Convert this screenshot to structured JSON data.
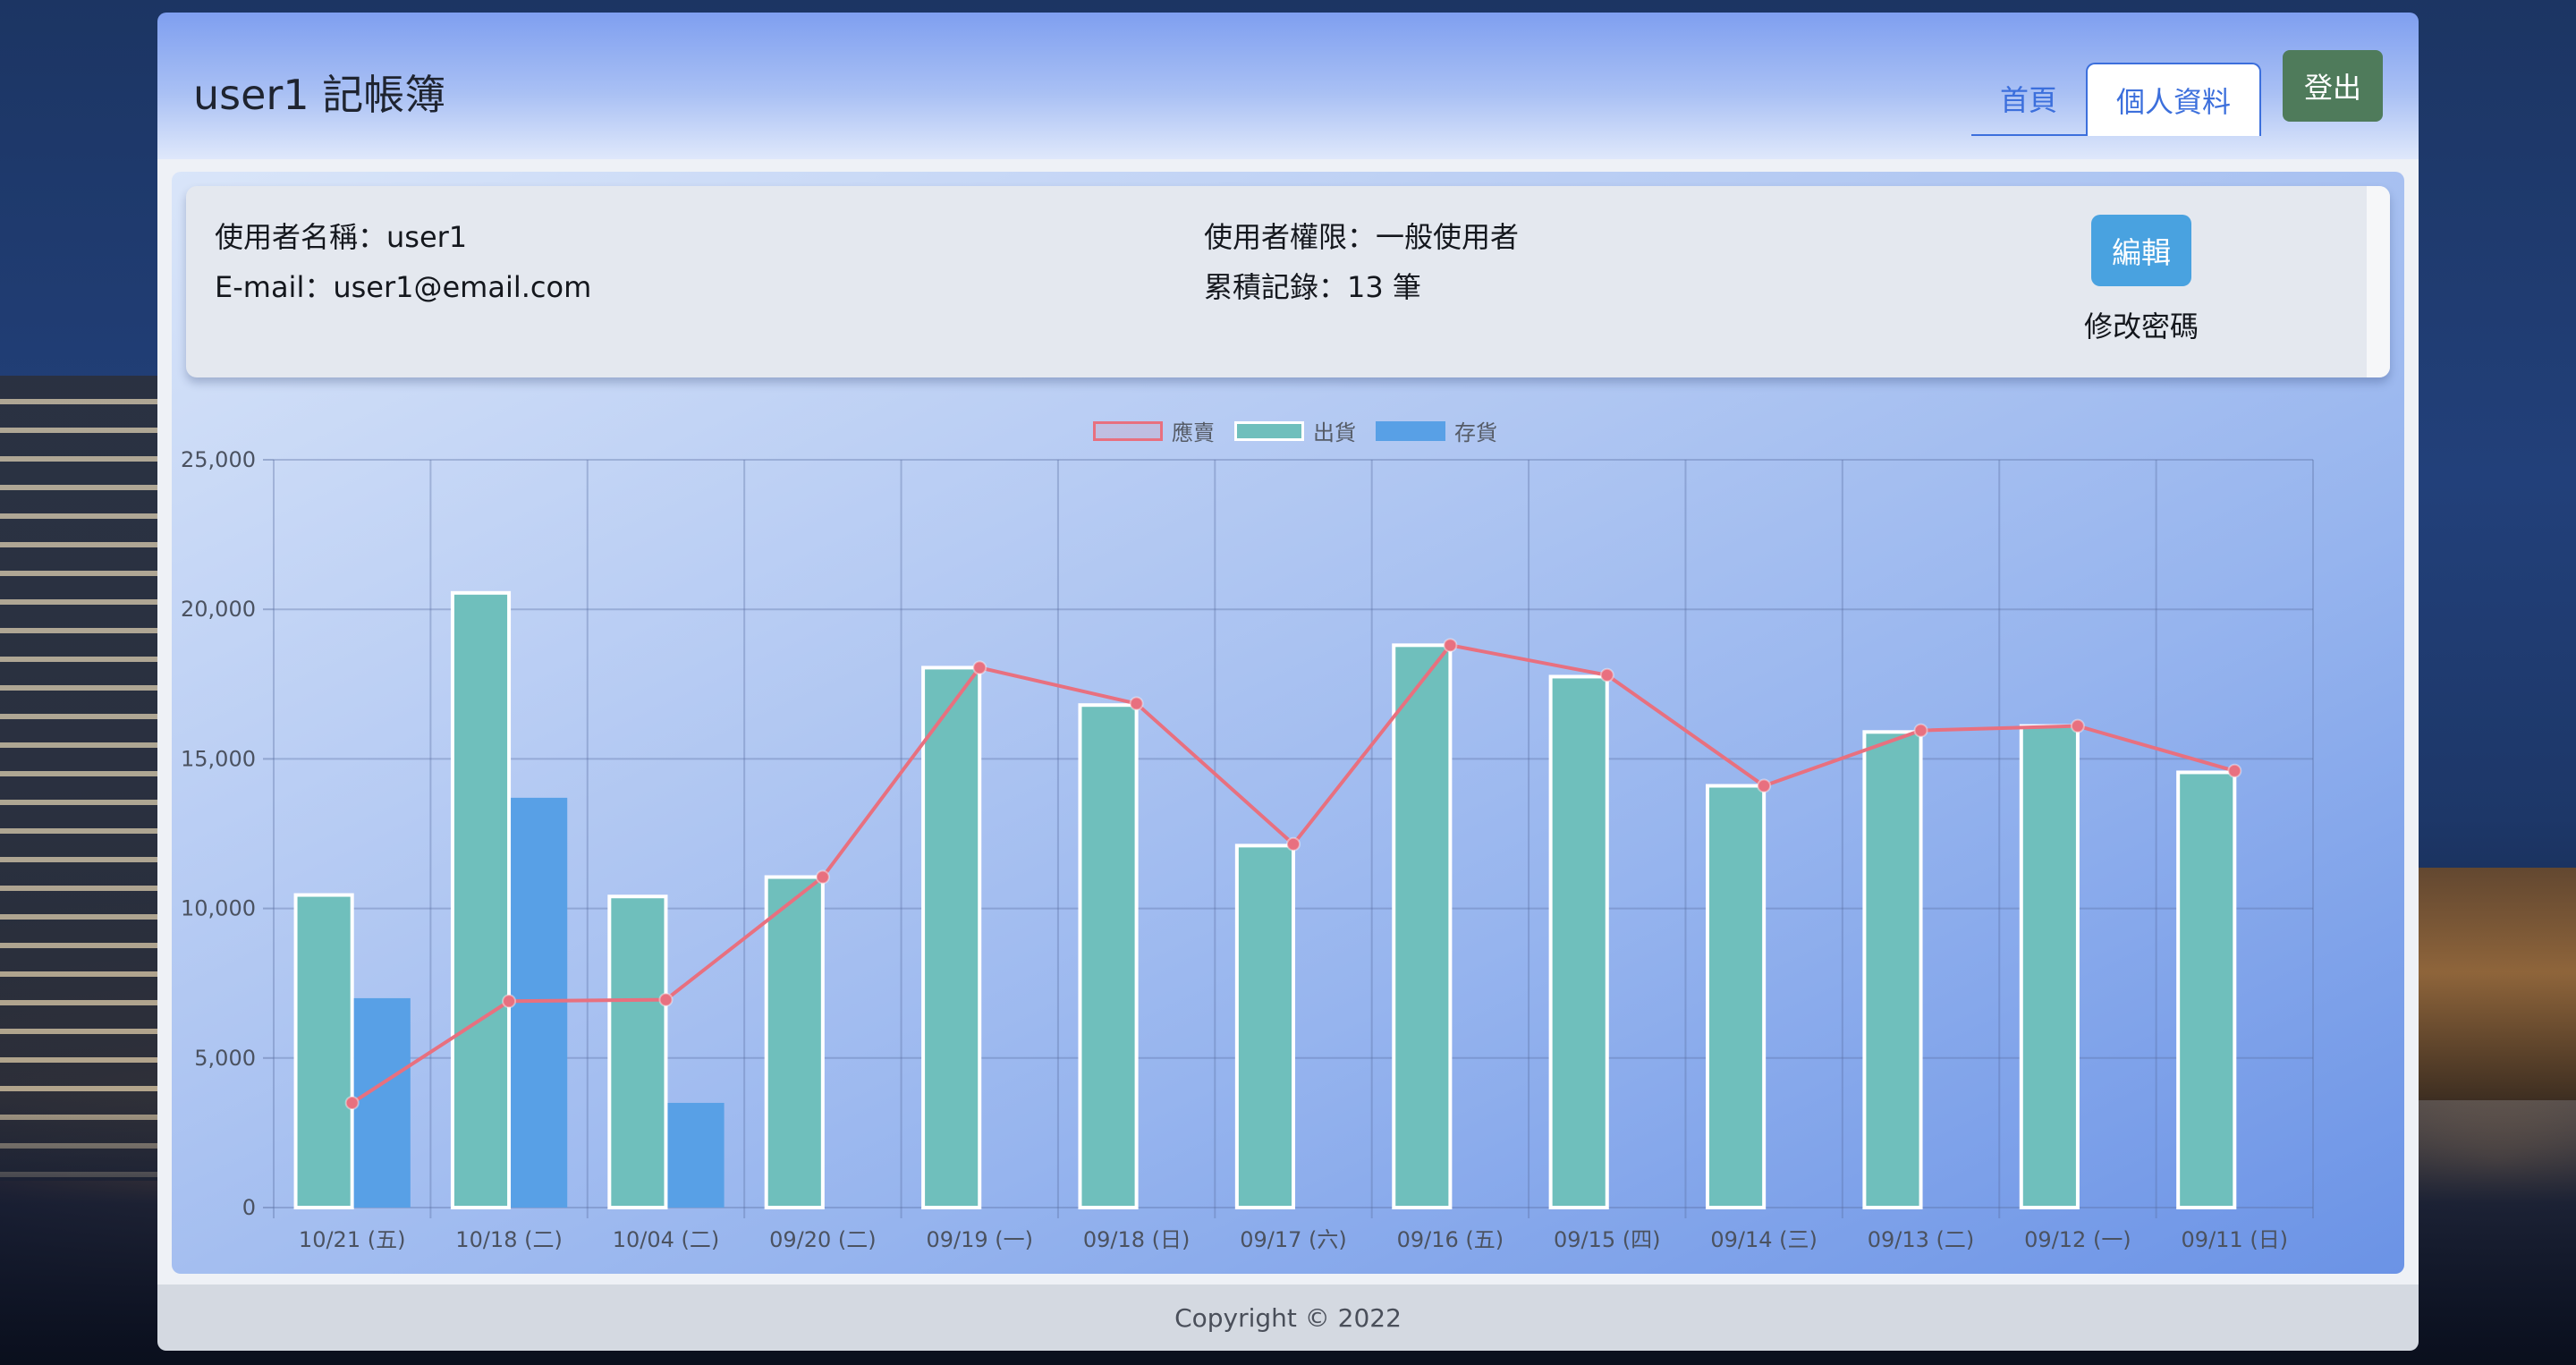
{
  "header": {
    "title": "user1 記帳簿",
    "nav": [
      {
        "label": "首頁"
      },
      {
        "label": "個人資料"
      }
    ],
    "logout_label": "登出"
  },
  "profile": {
    "username_label": "使用者名稱：user1",
    "email_label": "E-mail：user1@email.com",
    "role_label": "使用者權限：一般使用者",
    "records_label": "累積記錄：13 筆",
    "edit_label": "編輯",
    "change_password_label": "修改密碼"
  },
  "footer": {
    "copyright": "Copyright © 2022"
  },
  "colors": {
    "line": "#e8707f",
    "outbound": "#6fbfbc",
    "stock": "#58a0e6"
  },
  "chart_data": {
    "type": "bar",
    "categories": [
      "10/21 (五)",
      "10/18 (二)",
      "10/04 (二)",
      "09/20 (二)",
      "09/19 (一)",
      "09/18 (日)",
      "09/17 (六)",
      "09/16 (五)",
      "09/15 (四)",
      "09/14 (三)",
      "09/13 (二)",
      "09/12 (一)",
      "09/11 (日)"
    ],
    "series": [
      {
        "name": "應賣",
        "kind": "line",
        "values": [
          3500,
          6900,
          6950,
          11050,
          18050,
          16850,
          12150,
          18800,
          17800,
          14100,
          15950,
          16100,
          14600
        ]
      },
      {
        "name": "出貨",
        "kind": "bar",
        "values": [
          10450,
          20550,
          10400,
          11050,
          18050,
          16800,
          12100,
          18800,
          17750,
          14100,
          15900,
          16100,
          14550
        ]
      },
      {
        "name": "存貨",
        "kind": "bar",
        "values": [
          7000,
          13700,
          3500,
          0,
          0,
          0,
          0,
          0,
          0,
          0,
          0,
          0,
          0
        ]
      }
    ],
    "y_ticks": [
      "0",
      "5,000",
      "10,000",
      "15,000",
      "20,000",
      "25,000"
    ],
    "ylim": [
      0,
      25000
    ],
    "grid": true,
    "legend": "top-center"
  }
}
